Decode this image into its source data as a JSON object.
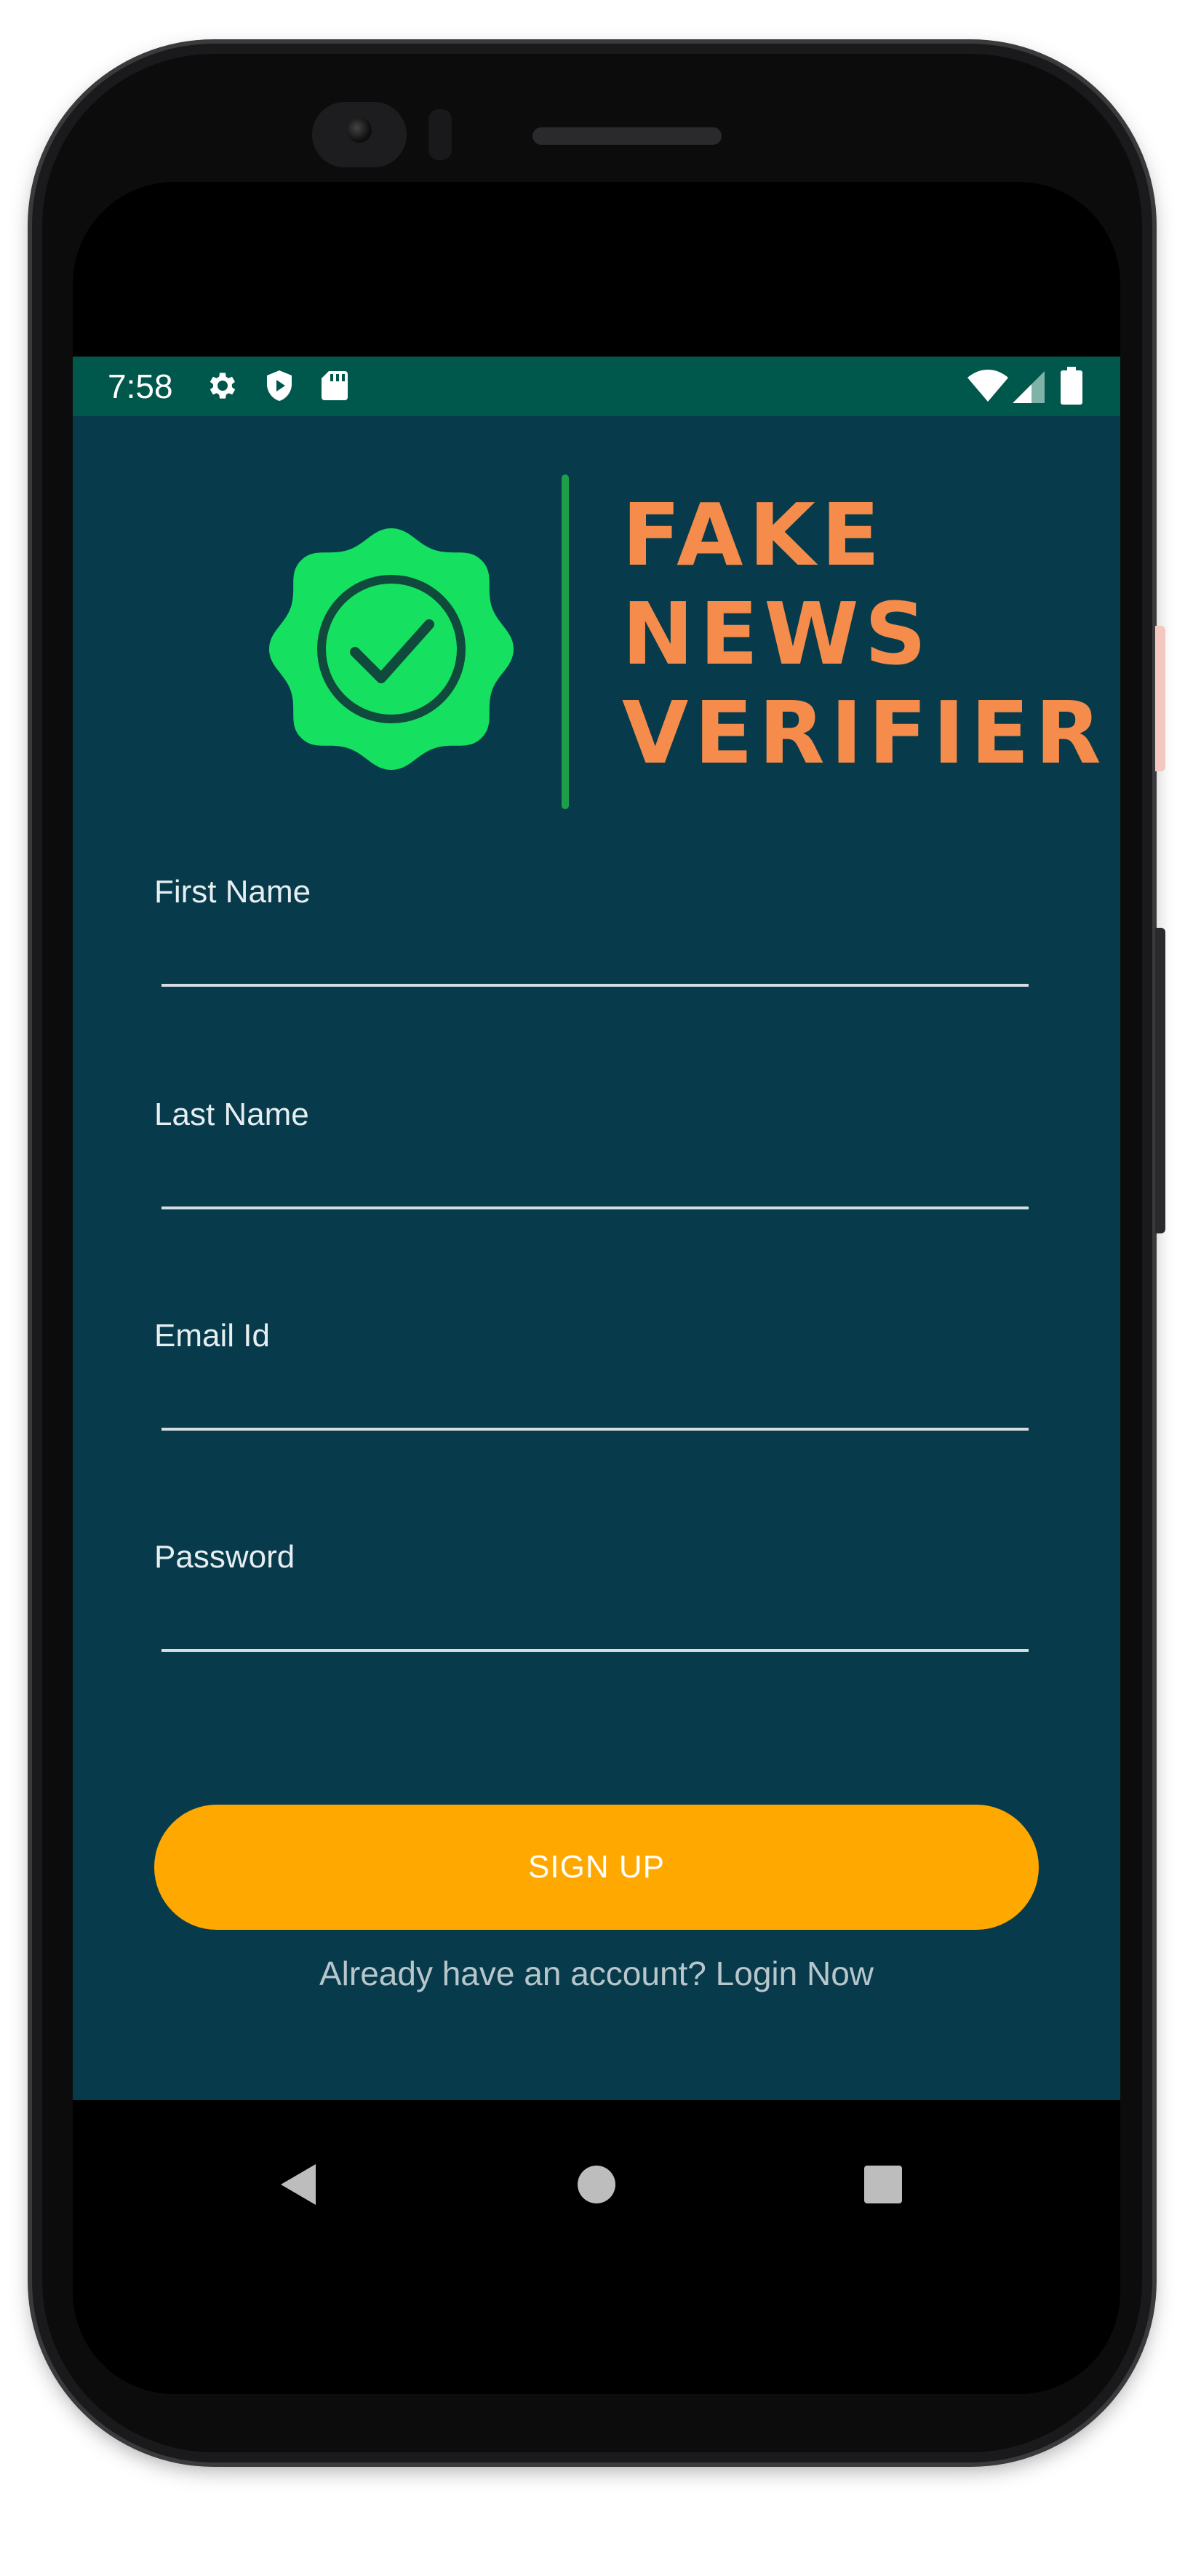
{
  "status_bar": {
    "time": "7:58",
    "left_icons": [
      "gear-icon",
      "shield-play-icon",
      "sd-card-icon"
    ],
    "right_icons": [
      "wifi-icon",
      "cell-signal-icon",
      "battery-icon"
    ],
    "background_color": "#00574b"
  },
  "logo": {
    "lines": [
      "FAKE",
      "NEWS",
      "VERIFIER"
    ],
    "badge_icon": "check-badge-icon",
    "text_color": "#f58c4b",
    "badge_color": "#16e060",
    "divider_color": "#1e9e4a"
  },
  "form": {
    "fields": [
      {
        "label": "First Name",
        "value": ""
      },
      {
        "label": "Last Name",
        "value": ""
      },
      {
        "label": "Email Id",
        "value": ""
      },
      {
        "label": "Password",
        "value": ""
      }
    ],
    "submit_label": "SIGN UP",
    "submit_color": "#ffa800",
    "login_prompt": "Already have an account? Login Now"
  },
  "app_background": "#073b4c",
  "navigation": {
    "buttons": [
      "back-icon",
      "home-icon",
      "recents-icon"
    ]
  }
}
